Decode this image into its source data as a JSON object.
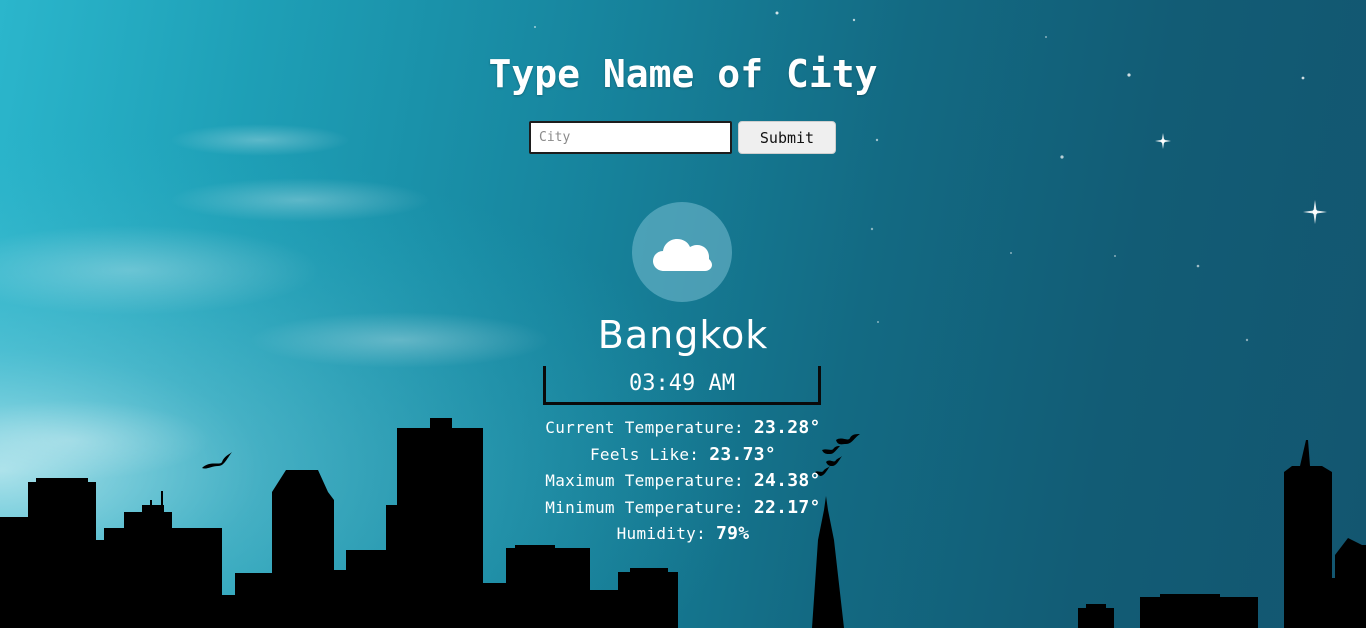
{
  "header": {
    "title": "Type Name of City"
  },
  "search": {
    "placeholder": "City",
    "value": "",
    "submit_label": "Submit"
  },
  "weather": {
    "icon": "cloud-icon",
    "city": "Bangkok",
    "time": "03:49 AM",
    "stats": [
      {
        "label": "Current Temperature: ",
        "value": "23.28°"
      },
      {
        "label": "Feels Like: ",
        "value": "23.73°"
      },
      {
        "label": "Maximum Temperature: ",
        "value": "24.38°"
      },
      {
        "label": "Minimum Temperature: ",
        "value": "22.17°"
      },
      {
        "label": "Humidity: ",
        "value": "79%"
      }
    ]
  },
  "colors": {
    "sky_light": "#2bb6cc",
    "sky_dark": "#135670",
    "skyline": "#000000",
    "text": "#ffffff"
  }
}
